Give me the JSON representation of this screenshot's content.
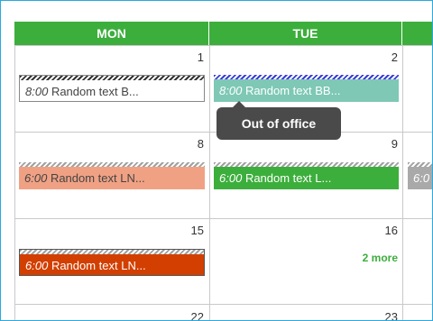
{
  "days": {
    "mon": "MON",
    "tue": "TUE"
  },
  "day_numbers": {
    "d1": "1",
    "d2": "2",
    "d8": "8",
    "d9": "9",
    "d15": "15",
    "d16": "16",
    "d22": "22",
    "d23": "23"
  },
  "events": {
    "e1": {
      "time": "8:00",
      "text": "Random text B..."
    },
    "e2": {
      "time": "8:00",
      "text": "Random text BB..."
    },
    "e3": {
      "time": "6:00",
      "text": "Random text LN..."
    },
    "e4": {
      "time": "6:00",
      "text": "Random text L..."
    },
    "e5": {
      "time": "6:0"
    },
    "e6": {
      "time": "6:00",
      "text": "Random text LN..."
    }
  },
  "tooltip": "Out of office",
  "more_link": "2 more",
  "colors": {
    "header": "#3cae3c",
    "salmon": "#f0a184",
    "teal": "#7ec8b5",
    "green": "#3cae3c",
    "gray": "#a9a9a9",
    "red": "#d23f00",
    "frame": "#29a9e0"
  }
}
